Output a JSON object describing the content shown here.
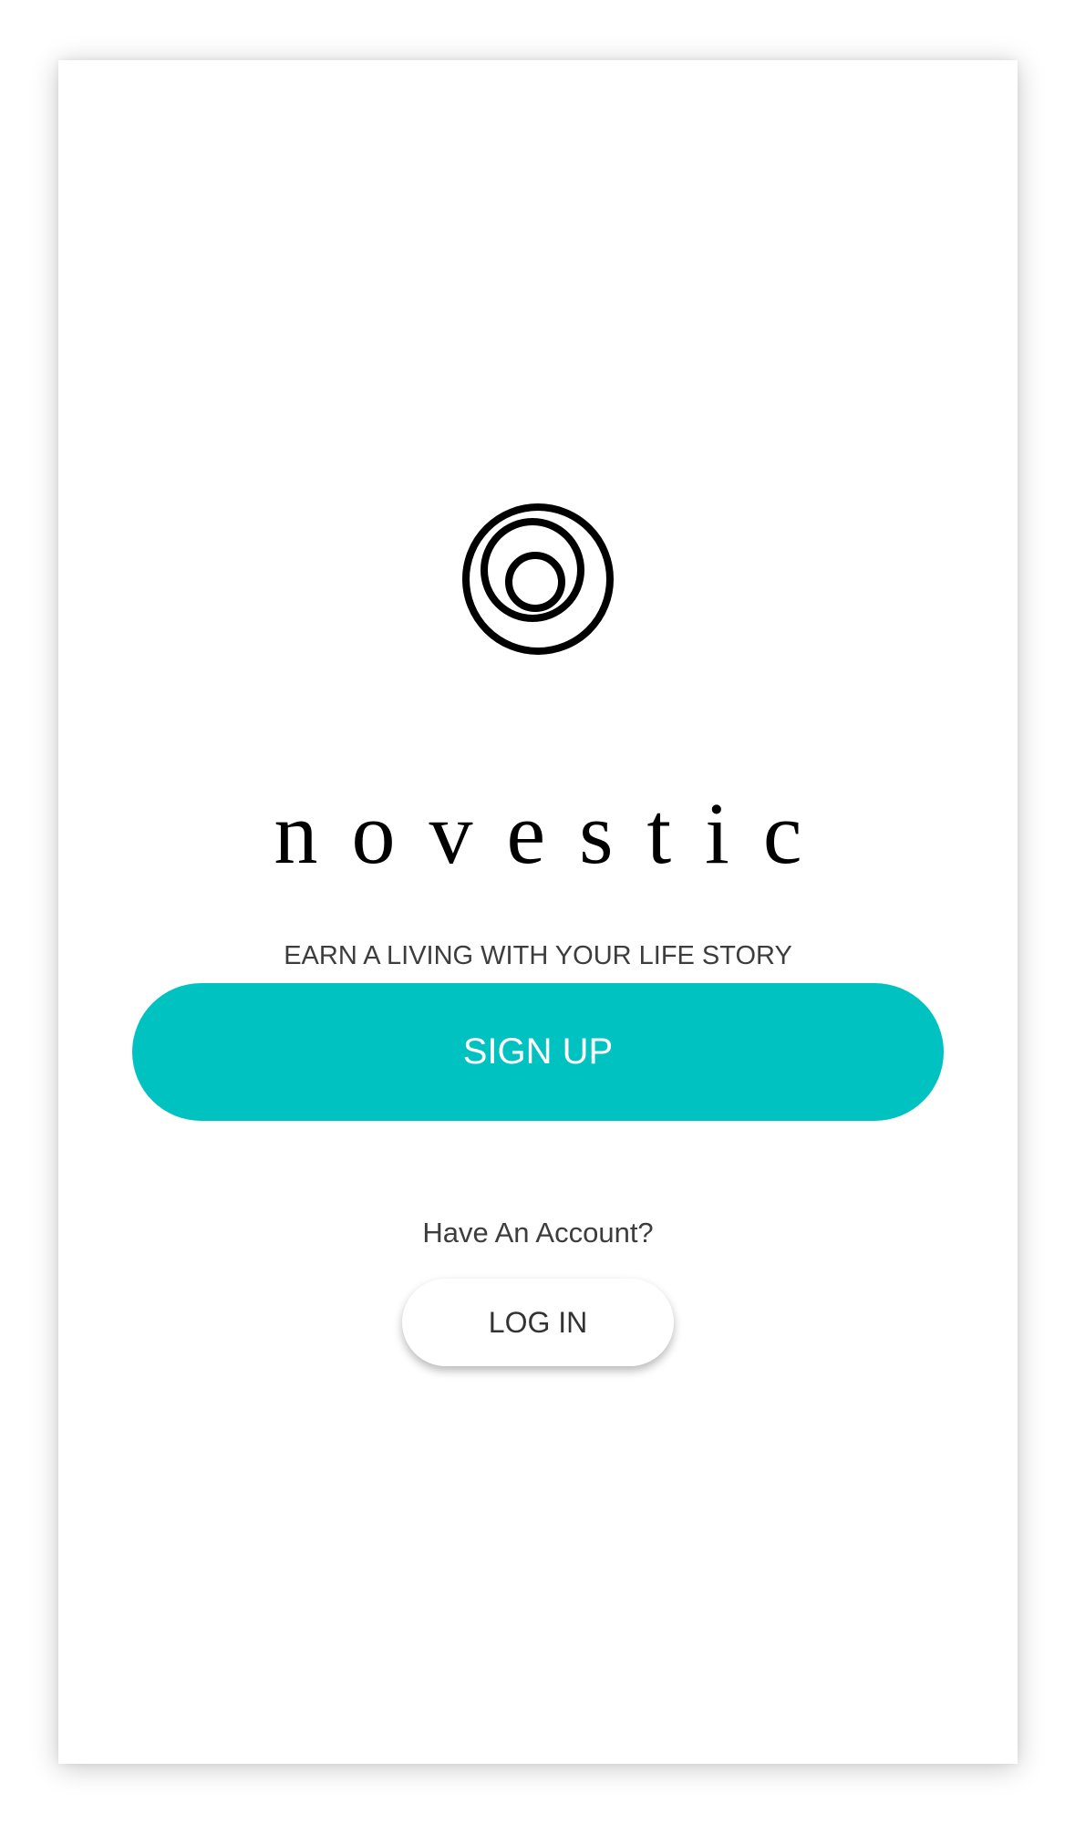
{
  "brand": {
    "logo_icon": "nested-rings-logo-icon",
    "name": "novestic",
    "tagline": "EARN A LIVING WITH YOUR LIFE STORY"
  },
  "actions": {
    "signup_label": "SIGN UP",
    "have_account_text": "Have An Account?",
    "login_label": "LOG IN"
  },
  "colors": {
    "accent": "#00c2c0",
    "text": "#3d3d3d",
    "background": "#ffffff"
  }
}
